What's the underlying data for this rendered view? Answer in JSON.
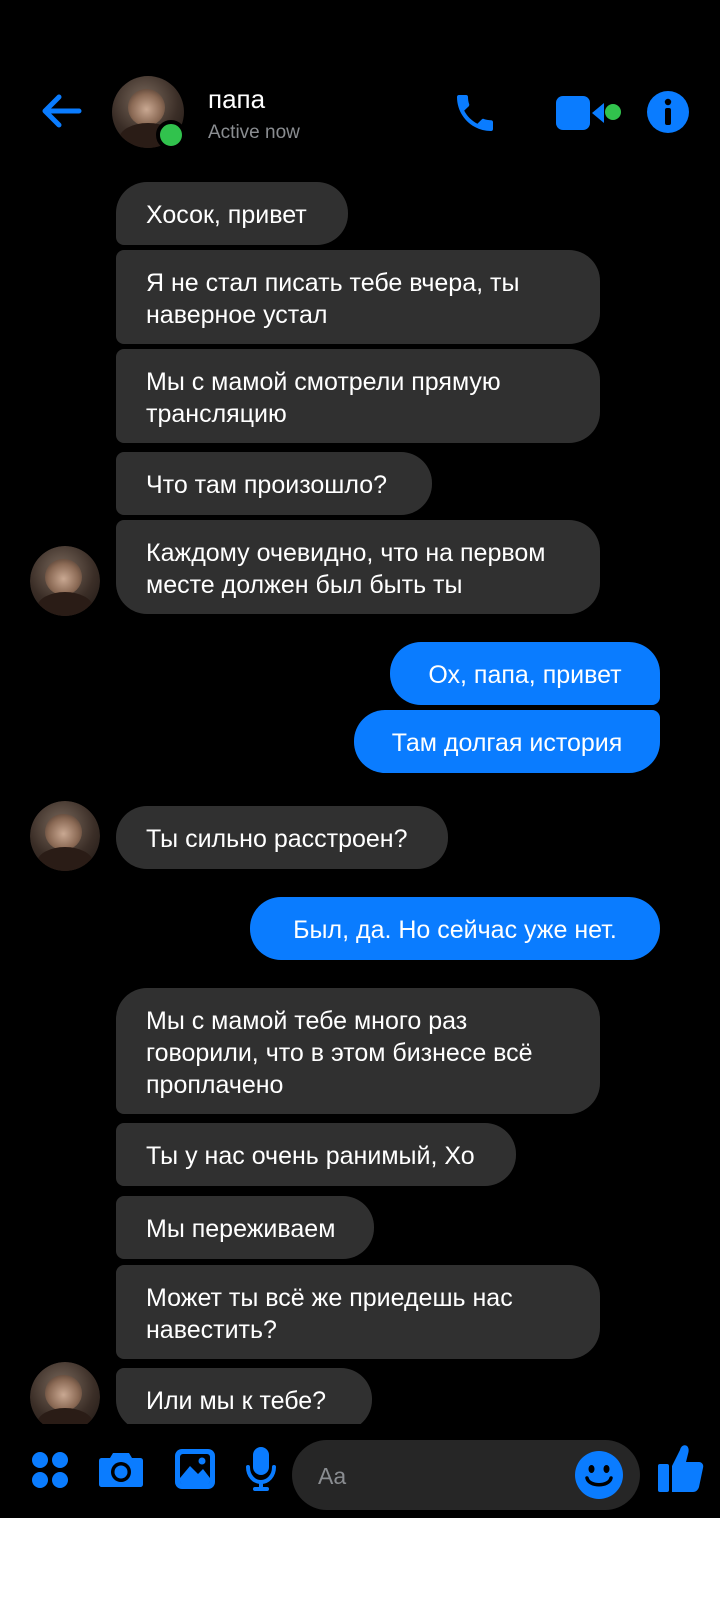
{
  "header": {
    "contact_name": "папа",
    "status": "Active now"
  },
  "messages": [
    {
      "from": "them",
      "text": "Хосок, привет"
    },
    {
      "from": "them",
      "text": "Я не стал писать тебе вчера, ты наверное устал"
    },
    {
      "from": "them",
      "text": "Мы с мамой смотрели прямую трансляцию"
    },
    {
      "from": "them",
      "text": "Что там произошло?"
    },
    {
      "from": "them",
      "text": "Каждому очевидно, что на первом месте должен был быть ты"
    },
    {
      "from": "me",
      "text": "Ох, папа, привет"
    },
    {
      "from": "me",
      "text": "Там долгая история"
    },
    {
      "from": "them",
      "text": "Ты сильно расстроен?"
    },
    {
      "from": "me",
      "text": "Был, да. Но сейчас уже нет."
    },
    {
      "from": "them",
      "text": "Мы с мамой тебе много раз говорили, что в этом бизнесе всё проплачено"
    },
    {
      "from": "them",
      "text": "Ты у нас очень ранимый, Хо"
    },
    {
      "from": "them",
      "text": "Мы переживаем"
    },
    {
      "from": "them",
      "text": "Может ты всё же приедешь нас навестить?"
    },
    {
      "from": "them",
      "text": "Или мы к тебе?"
    }
  ],
  "composer": {
    "placeholder": "Aa"
  },
  "colors": {
    "accent": "#0a7cff",
    "incoming_bubble": "#303030",
    "online": "#31c24d",
    "background": "#000000"
  },
  "icons": {
    "back": "arrow-left-icon",
    "call": "phone-icon",
    "video": "video-camera-icon",
    "info": "info-icon",
    "menu": "four-dots-icon",
    "camera": "camera-icon",
    "gallery": "image-icon",
    "voice": "microphone-icon",
    "emoji": "smiley-icon",
    "like": "thumbs-up-icon"
  }
}
